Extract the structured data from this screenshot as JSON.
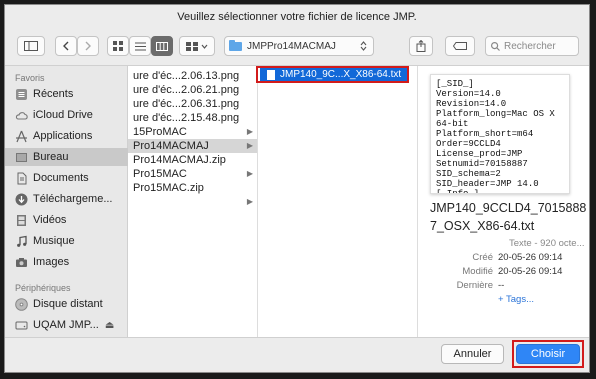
{
  "dialog": {
    "title": "Veuillez sélectionner votre fichier de licence JMP."
  },
  "toolbar": {
    "path": "JMPPro14MACMAJ",
    "search_placeholder": "Rechercher"
  },
  "sidebar": {
    "favorites_header": "Favoris",
    "favorites": [
      {
        "label": "Récents",
        "icon": "clock-icon"
      },
      {
        "label": "iCloud Drive",
        "icon": "cloud-icon"
      },
      {
        "label": "Applications",
        "icon": "applications-icon"
      },
      {
        "label": "Bureau",
        "icon": "desktop-icon"
      },
      {
        "label": "Documents",
        "icon": "document-icon"
      },
      {
        "label": "Téléchargeme...",
        "icon": "download-icon"
      },
      {
        "label": "Vidéos",
        "icon": "film-icon"
      },
      {
        "label": "Musique",
        "icon": "music-icon"
      },
      {
        "label": "Images",
        "icon": "camera-icon"
      }
    ],
    "devices_header": "Périphériques",
    "devices": [
      {
        "label": "Disque distant",
        "icon": "disc-icon"
      },
      {
        "label": "UQAM JMP...",
        "icon": "drive-icon"
      }
    ],
    "eject_glyph": "⏏"
  },
  "column2": [
    {
      "label": "ure d'éc...2.06.13.png",
      "folder": false
    },
    {
      "label": "ure d'éc...2.06.21.png",
      "folder": false
    },
    {
      "label": "ure d'éc...2.06.31.png",
      "folder": false
    },
    {
      "label": "ure d'éc...2.15.48.png",
      "folder": false
    },
    {
      "label": "15ProMAC",
      "folder": true
    },
    {
      "label": "Pro14MACMAJ",
      "folder": true
    },
    {
      "label": "Pro14MACMAJ.zip",
      "folder": false
    },
    {
      "label": "Pro15MAC",
      "folder": true
    },
    {
      "label": "Pro15MAC.zip",
      "folder": false
    }
  ],
  "column3": {
    "selected_file": "JMP140_9C...X_X86-64.txt"
  },
  "preview": {
    "content": "[_SID_]\nVersion=14.0\nRevision=14.0\nPlatform_long=Mac OS X\n64-bit\nPlatform_short=m64\nOrder=9CCLD4\nLicense_prod=JMP\nSetnumid=70158887\nSID_schema=2\nSID_header=JMP 14.0\n[_Info_]",
    "filename": "JMP140_9CCLD4_70158887_OSX_X86-64.txt",
    "kind": "Texte - 920 octe...",
    "created_label": "Créé",
    "created_value": "20-05-26 09:14",
    "modified_label": "Modifié",
    "modified_value": "20-05-26 09:14",
    "last_opened_label": "Dernière",
    "last_opened_value": "--",
    "tags_link": "+ Tags..."
  },
  "buttons": {
    "cancel": "Annuler",
    "choose": "Choisir"
  },
  "colors": {
    "accent": "#2f86f6",
    "selection": "#1268d8",
    "highlight_box": "#d21b1b"
  }
}
